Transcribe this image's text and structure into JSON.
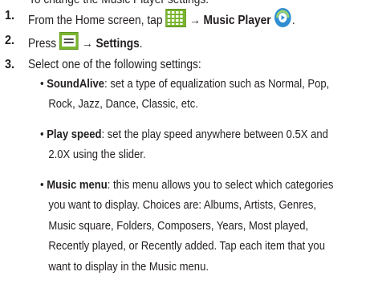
{
  "intro": {
    "text": "To change the Music Player settings:"
  },
  "steps": [
    {
      "number": "1.",
      "prefix": "From the Home screen, tap",
      "arrow": "→",
      "bold_label": "Music Player",
      "icons": [
        "apps-grid-icon",
        "music-player-icon"
      ],
      "suffix": "."
    },
    {
      "number": "2.",
      "prefix": "Press",
      "arrow": "→",
      "bold_label": "Settings",
      "icons": [
        "menu-key-icon"
      ],
      "suffix": "."
    },
    {
      "number": "3.",
      "text": "Select one of the following settings:"
    }
  ],
  "settings": [
    {
      "name": "SoundAlive",
      "lines": [
        ": set a type of equalization such as Normal, Pop,",
        "Rock, Jazz, Dance, Classic, etc."
      ]
    },
    {
      "name": "Play speed",
      "lines": [
        ": set the play speed anywhere between 0.5X and",
        "2.0X using the slider."
      ]
    },
    {
      "name": "Music menu",
      "lines": [
        ": this menu allows you to select which categories",
        "you want to display. Choices are: Albums, Artists, Genres,",
        "Music square, Folders, Composers, Years, Most played,",
        "Recently played, or Recently added. Tap each item that you",
        "want to display in the Music menu."
      ]
    }
  ],
  "colors": {
    "text": "#231f20",
    "icon_green": "#7ab52f",
    "icon_dark": "#3d3d3d",
    "music_blue": "#2f8ed1"
  }
}
